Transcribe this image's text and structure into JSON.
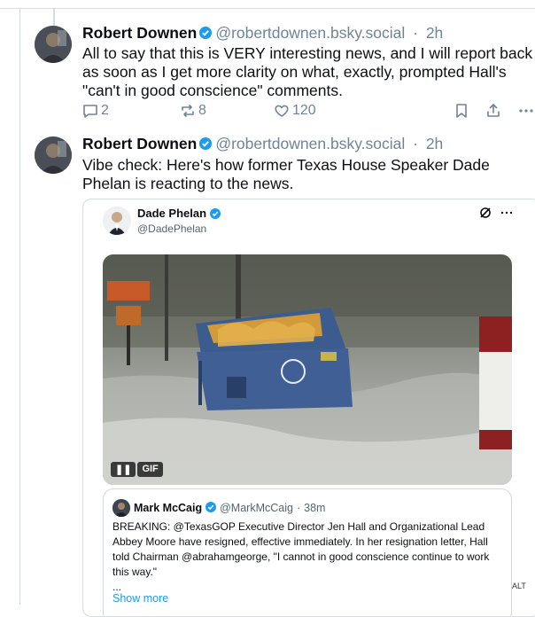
{
  "posts": [
    {
      "author": "Robert Downen",
      "handle": "@robertdownen.bsky.social",
      "time": "2h",
      "text": "All to say that this is VERY interesting news, and I will report back as soon as I get more clarity on what, exactly, prompted Hall's \"can't in good conscience\" comments.",
      "replies": "2",
      "reposts": "8",
      "likes": "120"
    },
    {
      "author": "Robert Downen",
      "handle": "@robertdownen.bsky.social",
      "time": "2h",
      "text": "Vibe check: Here's how former Texas House Speaker Dade Phelan is reacting to the news."
    }
  ],
  "embed": {
    "name": "Dade Phelan",
    "handle": "@DadePhelan",
    "gif_label": "GIF",
    "quote": {
      "name": "Mark McCaig",
      "handle": "@MarkMcCaig",
      "time": "38m",
      "text": "BREAKING: @TexasGOP Executive Director Jen Hall and Organizational Lead Abbey Moore have resigned, effective immediately. In her resignation letter, Hall told Chairman @abrahamgeorge, \"I cannot in good conscience continue to work this way.\"",
      "ellipsis": "...",
      "show_more": "Show more"
    }
  },
  "alt_label": "ALT",
  "separator": "·",
  "colors": {
    "verified": "#1d9bf0",
    "muted": "#6f8497",
    "border": "#d4dbe2"
  }
}
